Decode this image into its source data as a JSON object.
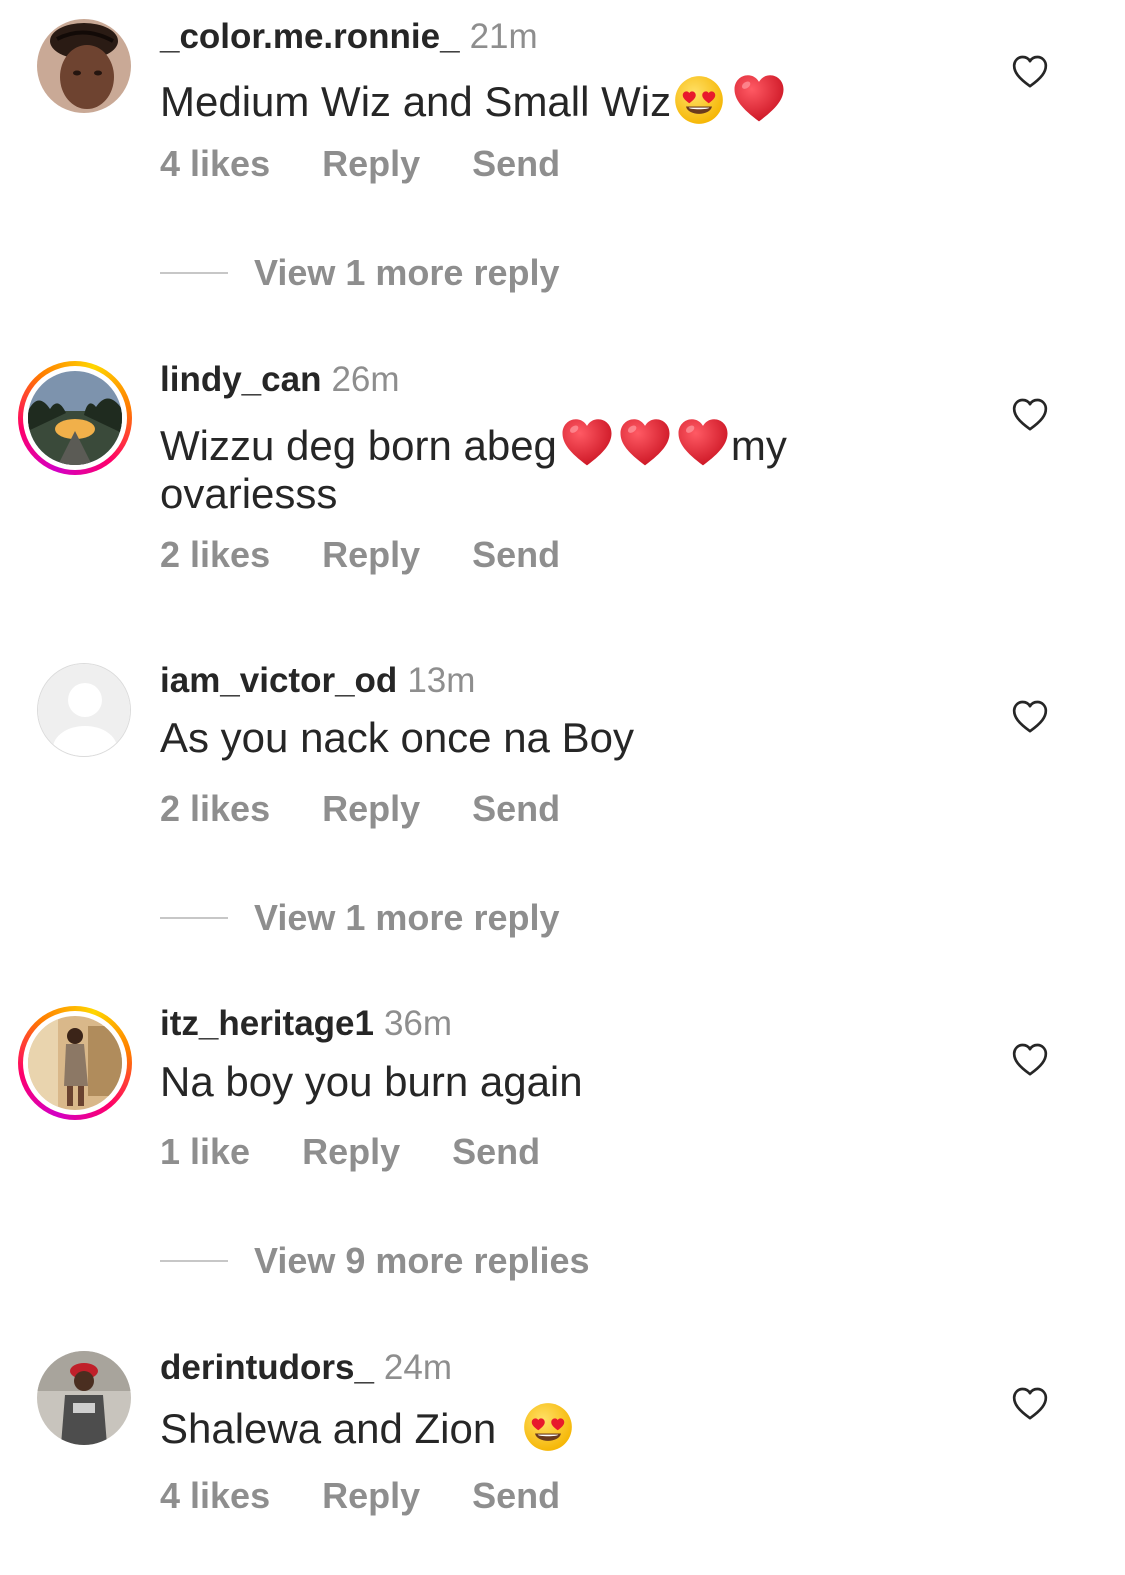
{
  "comments": [
    {
      "username": "_color.me.ronnie_",
      "time": "21m",
      "text": "Medium Wiz and Small Wiz",
      "emojis": [
        "heart-eyes",
        "red-heart"
      ],
      "likes": "4 likes",
      "reply": "Reply",
      "send": "Send",
      "view_more": "View 1 more reply"
    },
    {
      "username": "lindy_can",
      "time": "26m",
      "text_a": "Wizzu deg born abeg",
      "text_b": "my",
      "text_c": "ovariesss",
      "likes": "2 likes",
      "reply": "Reply",
      "send": "Send"
    },
    {
      "username": "iam_victor_od",
      "time": "13m",
      "text": "As you nack once na Boy",
      "likes": "2 likes",
      "reply": "Reply",
      "send": "Send",
      "view_more": "View 1 more reply"
    },
    {
      "username": "itz_heritage1",
      "time": "36m",
      "text": "Na boy you burn again",
      "likes": "1 like",
      "reply": "Reply",
      "send": "Send",
      "view_more": "View 9 more replies"
    },
    {
      "username": "derintudors_",
      "time": "24m",
      "text": "Shalewa and Zion ",
      "likes": "4 likes",
      "reply": "Reply",
      "send": "Send"
    }
  ],
  "colors": {
    "text_primary": "#262626",
    "text_secondary": "#8e8e8e",
    "heart_red": "#e0162b"
  },
  "icons": [
    "heart-outline-icon",
    "heart-eyes-emoji",
    "red-heart-emoji",
    "default-avatar-icon"
  ]
}
